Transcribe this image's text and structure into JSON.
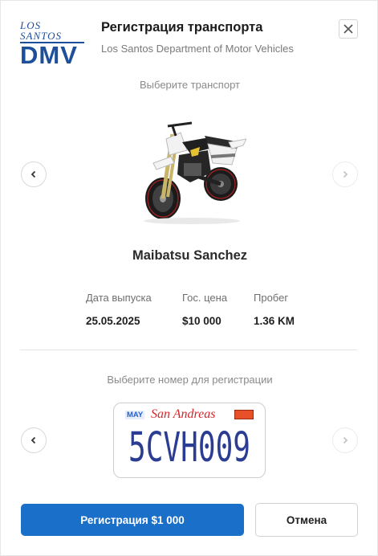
{
  "logo": {
    "top_text": "LOS SANTOS",
    "main_text": "DMV",
    "color": "#1d4f9a"
  },
  "header": {
    "title": "Регистрация транспорта",
    "subtitle": "Los Santos Department of Motor Vehicles"
  },
  "vehicle_section": {
    "caption": "Выберите транспорт",
    "vehicle_name": "Maibatsu Sanchez",
    "specs": [
      {
        "label": "Дата выпуска",
        "value": "25.05.2025"
      },
      {
        "label": "Гос. цена",
        "value": "$10 000"
      },
      {
        "label": "Пробег",
        "value": "1.36 KM"
      }
    ]
  },
  "plate_section": {
    "caption": "Выберите номер для регистрации",
    "plate": {
      "month": "MAY",
      "state": "San Andreas",
      "number": "5CVH009"
    }
  },
  "actions": {
    "register_label": "Регистрация $1 000",
    "cancel_label": "Отмена"
  },
  "colors": {
    "primary": "#1a6fc9",
    "plate_text": "#2a3d92",
    "plate_state": "#d2262c"
  }
}
